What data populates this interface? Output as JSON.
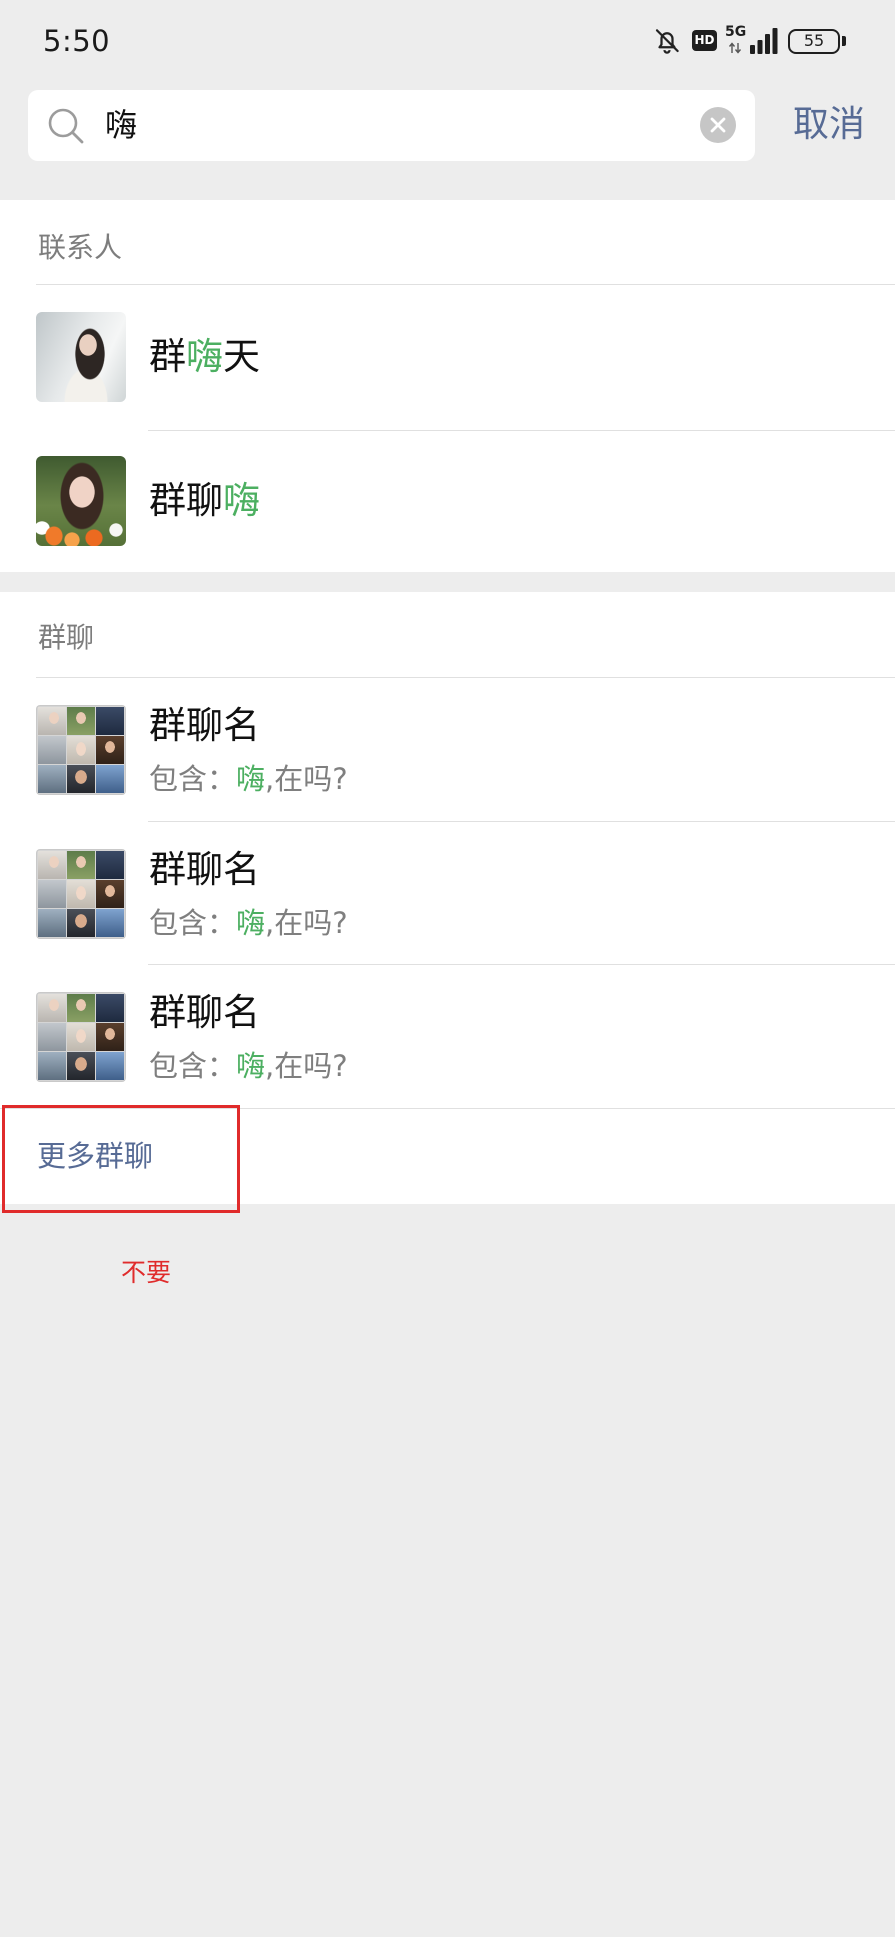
{
  "status_bar": {
    "time": "5:50",
    "hd_label": "HD",
    "network_label": "5G",
    "battery_level": "55"
  },
  "search": {
    "query": "嗨",
    "cancel_label": "取消"
  },
  "contacts_section": {
    "header": "联系人",
    "items": [
      {
        "name_before": "群",
        "name_match": "嗨",
        "name_after": "天"
      },
      {
        "name_before": "群聊",
        "name_match": "嗨",
        "name_after": ""
      }
    ]
  },
  "groups_section": {
    "header": "群聊",
    "items": [
      {
        "title": "群聊名",
        "detail_prefix": "包含：",
        "detail_match": "嗨",
        "detail_suffix": ",在吗?"
      },
      {
        "title": "群聊名",
        "detail_prefix": "包含：",
        "detail_match": "嗨",
        "detail_suffix": ",在吗?"
      },
      {
        "title": "群聊名",
        "detail_prefix": "包含：",
        "detail_match": "嗨",
        "detail_suffix": ",在吗?"
      }
    ],
    "more_label": "更多群聊"
  },
  "annotation": {
    "note": "不要",
    "color": "#e02b2b"
  },
  "icons": {
    "status": [
      "bell-off-icon",
      "hd-badge",
      "network-arrows-icon",
      "signal-icon",
      "battery-icon"
    ],
    "search": "search-icon",
    "clear": "clear-icon"
  },
  "colors": {
    "accent": "#576b95",
    "match_highlight": "#4caf61",
    "background": "#ededed"
  }
}
